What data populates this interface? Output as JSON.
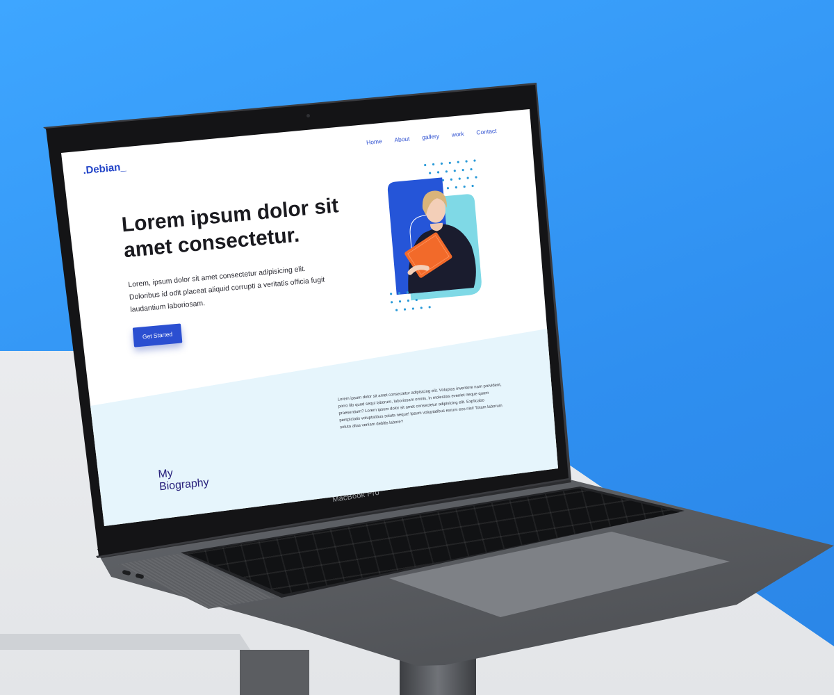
{
  "site": {
    "logo": ".Debian_",
    "nav": [
      "Home",
      "About",
      "gallery",
      "work",
      "Contact"
    ],
    "hero": {
      "title": "Lorem ipsum dolor sit amet consectetur.",
      "text": "Lorem, ipsum dolor sit amet consectetur adipisicing elit. Doloribus id odit placeat aliquid corrupti a veritatis officia fugit laudantium laboriosam.",
      "cta_label": "Get Started"
    },
    "bio": {
      "title_line1": "My",
      "title_line2": "Biography",
      "text": "Lorem ipsum dolor sit amet consectetur adipisicing elit. Voluptas inventore nam provident, porro illo quod sequi laborum, laboriosam omnis, in molestias eveniet neque quam praesentium? Lorem ipsum dolor sit amet consectetur adipisicing elit. Explicabo perspiciatis voluptatibus soluta neque! Ipsum voluptatibus earum eos nisi! Totam laborum soluta alias veniam debitis labore?"
    }
  },
  "device": {
    "brand_label": "MacBook Pro"
  },
  "colors": {
    "background": "#3ea6ff",
    "accent": "#2b4fd1",
    "hero_card_blue": "#2555d8",
    "hero_card_teal": "#7fd9e6",
    "book": "#f26a2a",
    "bio_band": "#e6f5fc",
    "bio_title": "#251e7a"
  },
  "icons": {
    "hero_art": "woman-holding-orange-book-illustration"
  }
}
